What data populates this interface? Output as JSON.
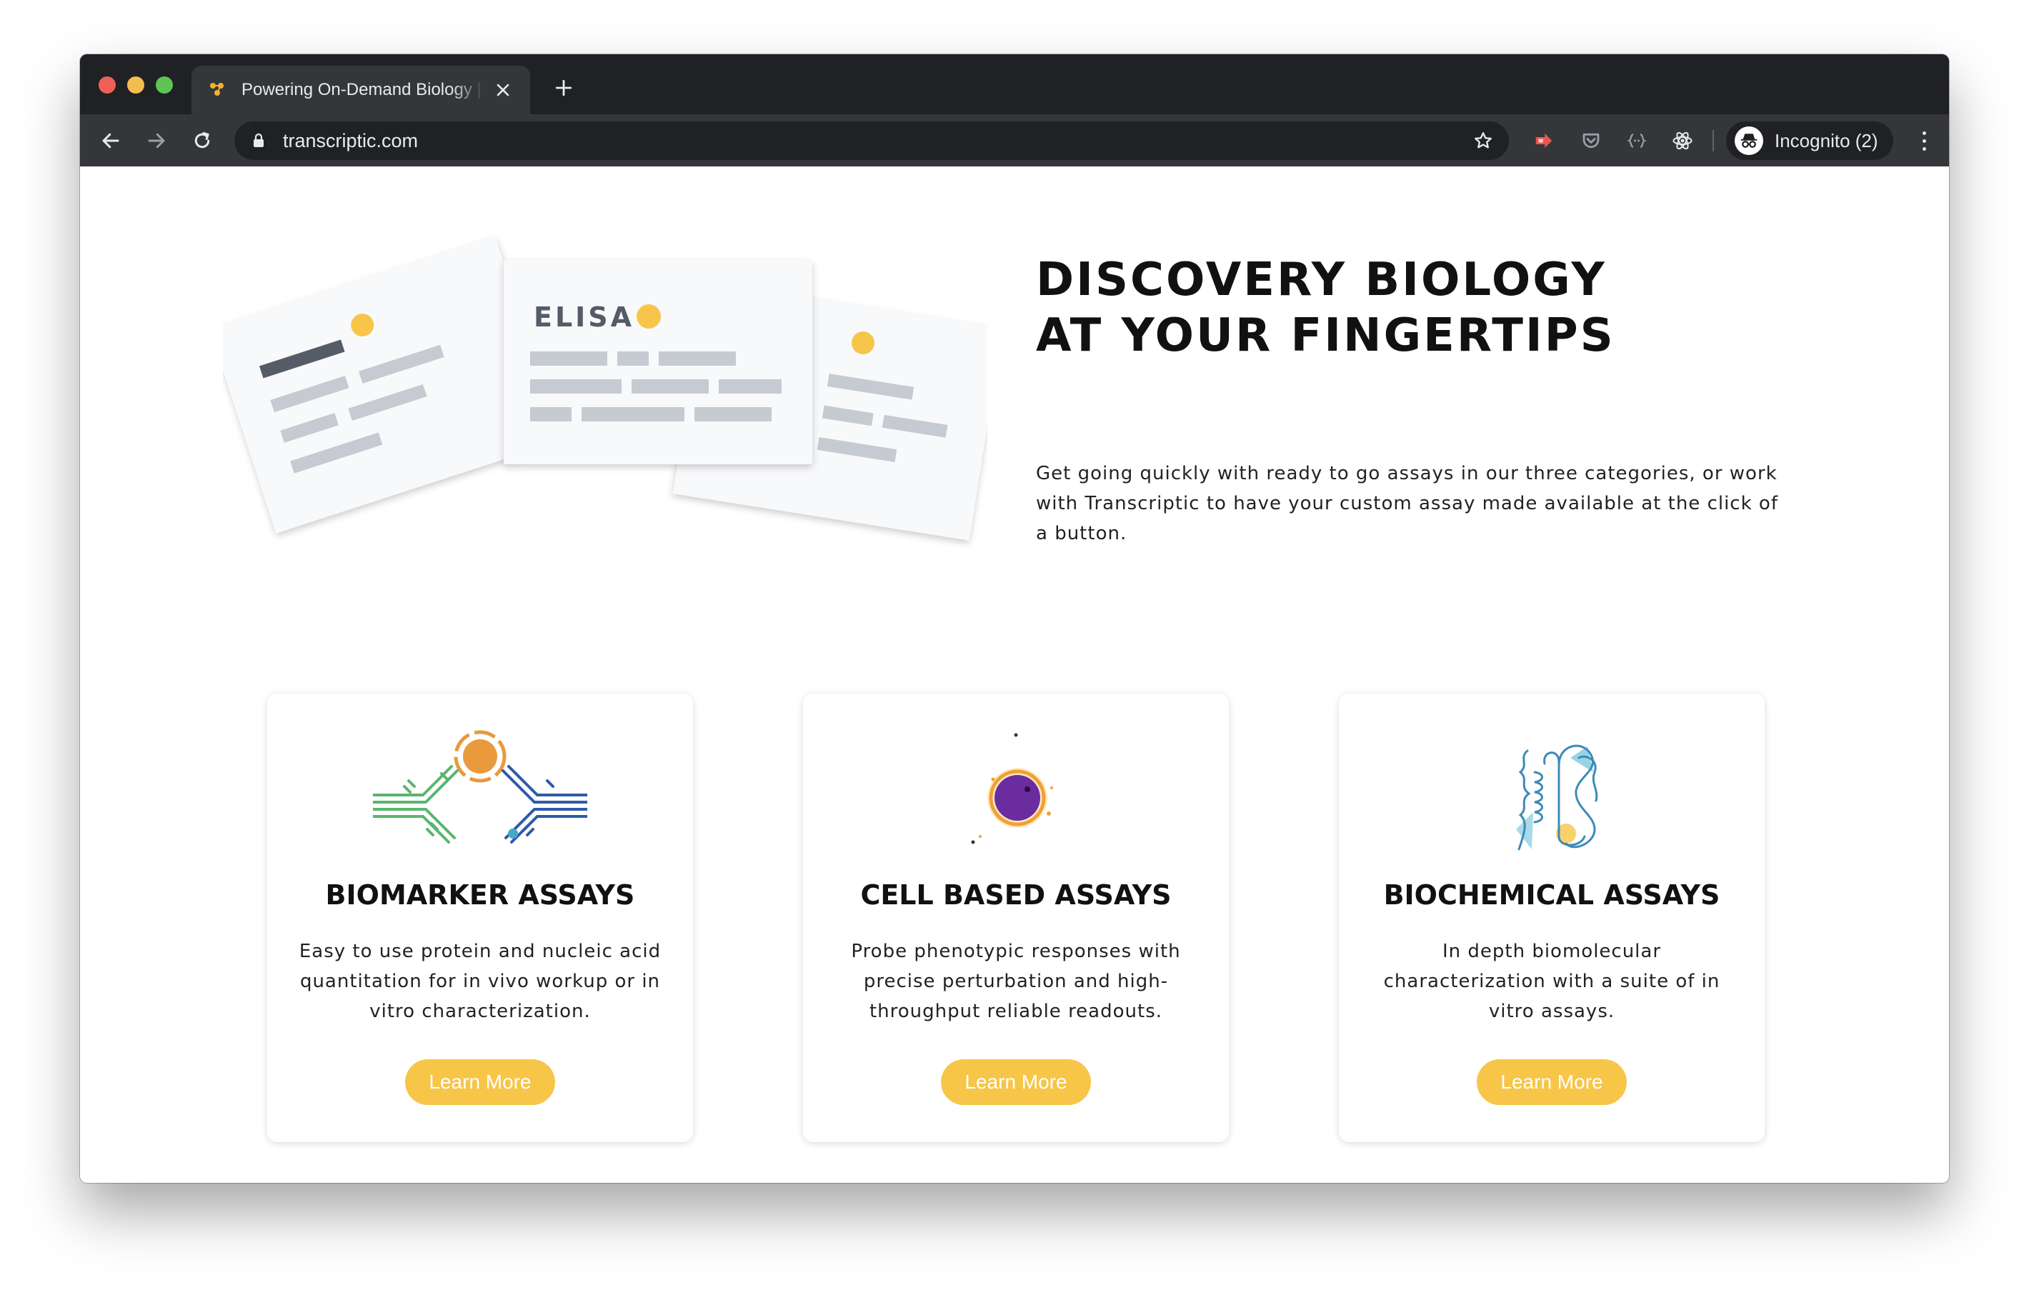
{
  "browser": {
    "tab_title": "Powering On-Demand Biology | Transcriptic",
    "url": "transcriptic.com",
    "profile_label": "Incognito (2)"
  },
  "hero": {
    "illustration_label": "ELISA",
    "title": "DISCOVERY BIOLOGY AT YOUR FINGERTIPS",
    "description": "Get going quickly with ready to go assays in our three categories, or work with Transcriptic to have your custom assay made available at the click of a button."
  },
  "cards": [
    {
      "icon": "antibody-icon",
      "title": "BIOMARKER ASSAYS",
      "description": "Easy to use protein and nucleic acid quantitation for in vivo workup or in vitro characterization.",
      "button": "Learn More"
    },
    {
      "icon": "cell-icon",
      "title": "CELL BASED ASSAYS",
      "description": "Probe phenotypic responses with precise perturbation and high-throughput reliable readouts.",
      "button": "Learn More"
    },
    {
      "icon": "protein-icon",
      "title": "BIOCHEMICAL ASSAYS",
      "description": "In depth biomolecular characterization with a suite of in vitro assays.",
      "button": "Learn More"
    }
  ],
  "colors": {
    "accent": "#f7c548",
    "chrome_dark": "#202124",
    "chrome_light": "#35363a"
  }
}
